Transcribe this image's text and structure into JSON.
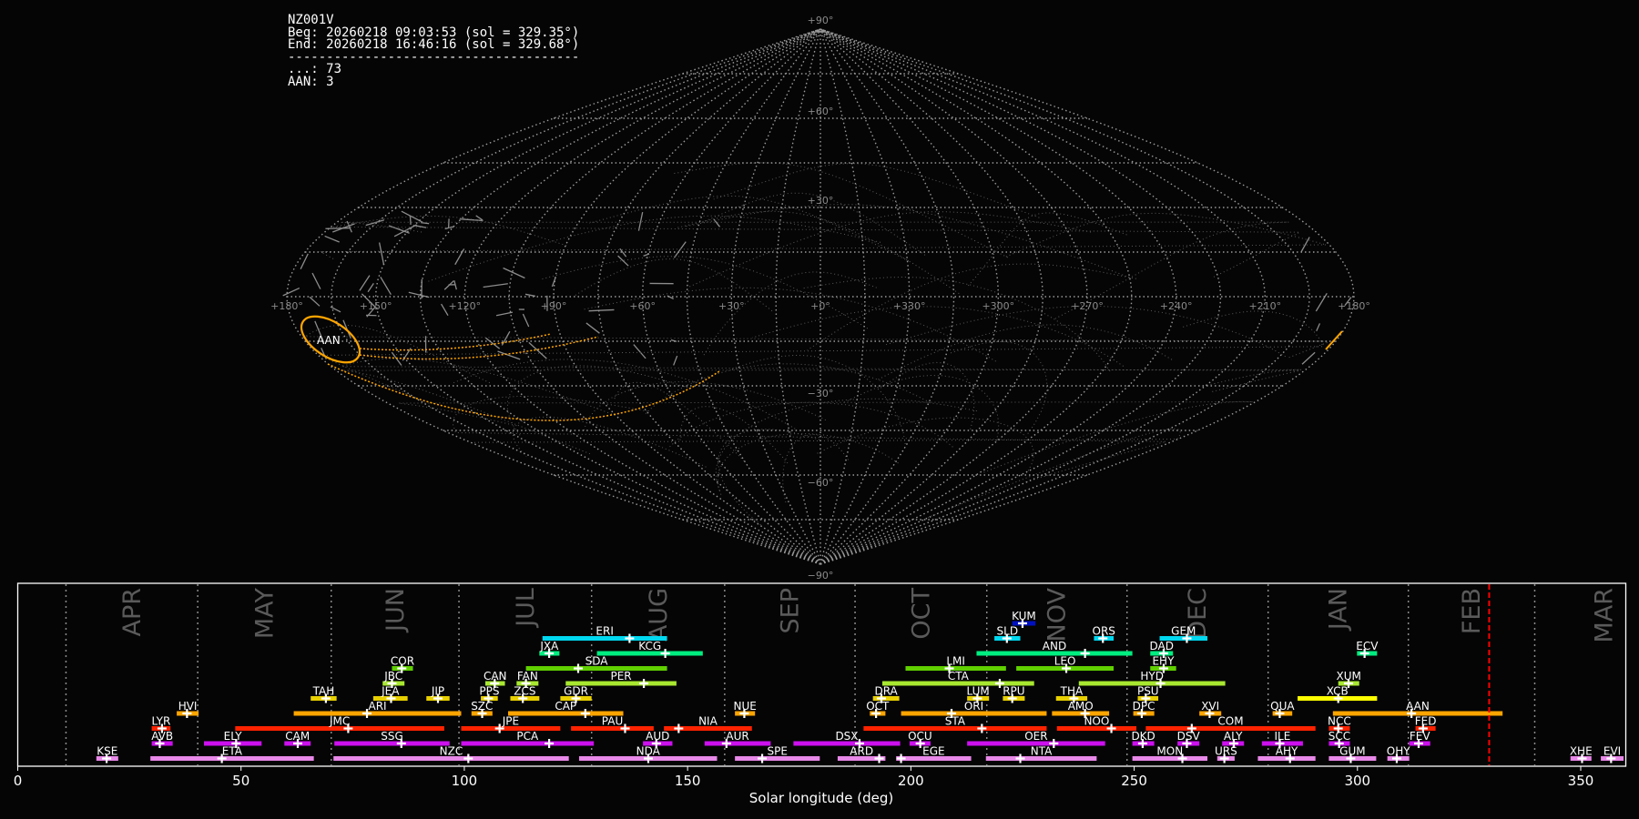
{
  "info": {
    "station": "NZ001V",
    "begin": "Beg: 20260218 09:03:53 (sol = 329.35°)",
    "end": "End: 20260218 16:46:16 (sol = 329.68°)",
    "separator": "--------------------------------------",
    "count_other": "...: 73",
    "count_aan": "AAN: 3"
  },
  "sky_map": {
    "projection": "sinusoidal",
    "lat_labels": [
      "+90°",
      "+60°",
      "+30°",
      "−30°",
      "−60°",
      "−90°"
    ],
    "lon_labels": [
      "+180°",
      "+150°",
      "+120°",
      "+90°",
      "+60°",
      "+30°",
      "+0°",
      "+330°",
      "+300°",
      "+270°",
      "+240°",
      "+210°",
      "+180°"
    ],
    "highlight_label": "AAN",
    "highlight_color": "#ffa500",
    "grid_color": "#9a9a9a"
  },
  "chart_data": {
    "type": "bar",
    "subtype": "horizontal activity-period bars with peak markers",
    "xlabel": "Solar longitude (deg)",
    "xlim": [
      0,
      360
    ],
    "xticks": [
      0,
      50,
      100,
      150,
      200,
      250,
      300,
      350
    ],
    "current_sol": 329.5,
    "current_sol_color": "#ff0000",
    "month_boundaries": [
      10.8,
      40.3,
      70.2,
      98.8,
      128.5,
      158.3,
      187.5,
      217.0,
      248.4,
      280.0,
      311.4,
      339.7
    ],
    "months": [
      "APR",
      "MAY",
      "JUN",
      "JUL",
      "AUG",
      "SEP",
      "OCT",
      "NOV",
      "DEC",
      "JAN",
      "FEB",
      "MAR"
    ],
    "showers": [
      {
        "code": "KUM",
        "beg": 222.7,
        "end": 227.9,
        "peak": 225.0,
        "row": 0,
        "color": "#0010c0"
      },
      {
        "code": "ERI",
        "beg": 117.5,
        "end": 145.4,
        "peak": 137.0,
        "row": 1,
        "color": "#00d8f0"
      },
      {
        "code": "SLD",
        "beg": 218.7,
        "end": 224.5,
        "peak": 221.5,
        "row": 1,
        "color": "#00d8f0"
      },
      {
        "code": "ORS",
        "beg": 241.0,
        "end": 245.4,
        "peak": 243.0,
        "row": 1,
        "color": "#00d8f0"
      },
      {
        "code": "GEM",
        "beg": 255.7,
        "end": 266.4,
        "peak": 261.8,
        "row": 1,
        "color": "#00d8f0"
      },
      {
        "code": "JXA",
        "beg": 116.8,
        "end": 121.3,
        "peak": 119.0,
        "row": 2,
        "color": "#00ee80"
      },
      {
        "code": "KCG",
        "beg": 129.7,
        "end": 153.4,
        "peak": 145.0,
        "row": 2,
        "color": "#00ee80"
      },
      {
        "code": "AND",
        "beg": 214.7,
        "end": 249.6,
        "peak": 239.0,
        "row": 2,
        "color": "#00ee80"
      },
      {
        "code": "DAD",
        "beg": 253.6,
        "end": 258.7,
        "peak": 256.6,
        "row": 2,
        "color": "#00ee80"
      },
      {
        "code": "ECV",
        "beg": 299.9,
        "end": 304.4,
        "peak": 301.6,
        "row": 2,
        "color": "#00ee80"
      },
      {
        "code": "COR",
        "beg": 83.8,
        "end": 88.5,
        "peak": 86.0,
        "row": 3,
        "color": "#60d000"
      },
      {
        "code": "SDA",
        "beg": 113.8,
        "end": 145.4,
        "peak": 125.5,
        "row": 3,
        "color": "#60d000"
      },
      {
        "code": "LMI",
        "beg": 198.8,
        "end": 221.3,
        "peak": 208.6,
        "row": 3,
        "color": "#60d000"
      },
      {
        "code": "LEO",
        "beg": 223.6,
        "end": 245.4,
        "peak": 234.8,
        "row": 3,
        "color": "#60d000"
      },
      {
        "code": "EHY",
        "beg": 253.6,
        "end": 259.4,
        "peak": 256.6,
        "row": 3,
        "color": "#60d000"
      },
      {
        "code": "JBC",
        "beg": 81.7,
        "end": 86.6,
        "peak": 83.8,
        "row": 4,
        "color": "#a8e830"
      },
      {
        "code": "CAN",
        "beg": 104.7,
        "end": 109.1,
        "peak": 106.8,
        "row": 4,
        "color": "#a8e830"
      },
      {
        "code": "FAN",
        "beg": 111.7,
        "end": 116.6,
        "peak": 113.8,
        "row": 4,
        "color": "#a8e830"
      },
      {
        "code": "PER",
        "beg": 122.7,
        "end": 147.5,
        "peak": 140.2,
        "row": 4,
        "color": "#a8e830"
      },
      {
        "code": "CTA",
        "beg": 193.6,
        "end": 227.6,
        "peak": 219.9,
        "row": 4,
        "color": "#a8e830"
      },
      {
        "code": "HYD",
        "beg": 237.6,
        "end": 270.4,
        "peak": 255.9,
        "row": 4,
        "color": "#a8e830"
      },
      {
        "code": "XUM",
        "beg": 295.7,
        "end": 300.4,
        "peak": 298.0,
        "row": 4,
        "color": "#a8e830"
      },
      {
        "code": "TAH",
        "beg": 65.6,
        "end": 71.4,
        "peak": 69.0,
        "row": 5,
        "color": "#e8d000"
      },
      {
        "code": "JEA",
        "beg": 79.6,
        "end": 87.3,
        "peak": 83.6,
        "row": 5,
        "color": "#e8d000"
      },
      {
        "code": "JIP",
        "beg": 91.5,
        "end": 96.7,
        "peak": 94.1,
        "row": 5,
        "color": "#e8d000"
      },
      {
        "code": "PPS",
        "beg": 103.7,
        "end": 107.5,
        "peak": 105.4,
        "row": 5,
        "color": "#e8d000"
      },
      {
        "code": "ZCS",
        "beg": 110.3,
        "end": 116.8,
        "peak": 113.1,
        "row": 5,
        "color": "#e8d000"
      },
      {
        "code": "GDR",
        "beg": 121.5,
        "end": 128.5,
        "peak": 125.0,
        "row": 5,
        "color": "#e8d000"
      },
      {
        "code": "DRA",
        "beg": 191.5,
        "end": 197.4,
        "peak": 193.4,
        "row": 5,
        "color": "#e8d000"
      },
      {
        "code": "LUM",
        "beg": 212.6,
        "end": 217.5,
        "peak": 214.9,
        "row": 5,
        "color": "#e8d000"
      },
      {
        "code": "RPU",
        "beg": 220.6,
        "end": 225.5,
        "peak": 222.7,
        "row": 5,
        "color": "#e8d000"
      },
      {
        "code": "THA",
        "beg": 232.5,
        "end": 239.5,
        "peak": 236.5,
        "row": 5,
        "color": "#e8d000"
      },
      {
        "code": "PSU",
        "beg": 250.8,
        "end": 255.4,
        "peak": 252.6,
        "row": 5,
        "color": "#e8d000"
      },
      {
        "code": "XCB",
        "beg": 286.6,
        "end": 304.4,
        "peak": 295.7,
        "row": 5,
        "color": "#ffff00"
      },
      {
        "code": "HVI",
        "beg": 35.6,
        "end": 40.5,
        "peak": 37.9,
        "row": 6,
        "color": "#ffa500"
      },
      {
        "code": "ARI",
        "beg": 61.8,
        "end": 99.3,
        "peak": 78.2,
        "row": 6,
        "color": "#ffa500"
      },
      {
        "code": "SZC",
        "beg": 101.6,
        "end": 106.3,
        "peak": 104.0,
        "row": 6,
        "color": "#ffa500"
      },
      {
        "code": "CAP",
        "beg": 109.8,
        "end": 135.6,
        "peak": 127.1,
        "row": 6,
        "color": "#ffa500"
      },
      {
        "code": "NUE",
        "beg": 160.6,
        "end": 165.1,
        "peak": 162.7,
        "row": 6,
        "color": "#ffa500"
      },
      {
        "code": "OCT",
        "beg": 190.8,
        "end": 194.3,
        "peak": 192.2,
        "row": 6,
        "color": "#ffa500"
      },
      {
        "code": "ORI",
        "beg": 197.8,
        "end": 230.4,
        "peak": 209.1,
        "row": 6,
        "color": "#ffa500"
      },
      {
        "code": "AMO",
        "beg": 231.6,
        "end": 244.4,
        "peak": 239.0,
        "row": 6,
        "color": "#ffa500"
      },
      {
        "code": "DPC",
        "beg": 249.8,
        "end": 254.5,
        "peak": 251.7,
        "row": 6,
        "color": "#ffa500"
      },
      {
        "code": "XVI",
        "beg": 264.6,
        "end": 269.5,
        "peak": 266.9,
        "row": 6,
        "color": "#ffa500"
      },
      {
        "code": "QUA",
        "beg": 281.0,
        "end": 285.4,
        "peak": 282.6,
        "row": 6,
        "color": "#ffa500"
      },
      {
        "code": "AAN",
        "beg": 294.5,
        "end": 332.5,
        "peak": 312.1,
        "row": 6,
        "color": "#ffa500"
      },
      {
        "code": "LYR",
        "beg": 30.0,
        "end": 34.2,
        "peak": 32.3,
        "row": 7,
        "color": "#ff2200"
      },
      {
        "code": "JMC",
        "beg": 48.7,
        "end": 95.5,
        "peak": 74.0,
        "row": 7,
        "color": "#ff2200"
      },
      {
        "code": "JPE",
        "beg": 99.3,
        "end": 121.5,
        "peak": 107.9,
        "row": 7,
        "color": "#ff2200"
      },
      {
        "code": "PAU",
        "beg": 123.9,
        "end": 142.4,
        "peak": 136.0,
        "row": 7,
        "color": "#ff2200"
      },
      {
        "code": "NIA",
        "beg": 144.7,
        "end": 164.4,
        "peak": 148.0,
        "row": 7,
        "color": "#ff2200"
      },
      {
        "code": "STA",
        "beg": 189.4,
        "end": 230.4,
        "peak": 215.9,
        "row": 7,
        "color": "#ff2200"
      },
      {
        "code": "NOO",
        "beg": 232.7,
        "end": 250.5,
        "peak": 244.9,
        "row": 7,
        "color": "#ff2200"
      },
      {
        "code": "COM",
        "beg": 252.6,
        "end": 290.6,
        "peak": 262.9,
        "row": 7,
        "color": "#ff2200"
      },
      {
        "code": "NCC",
        "beg": 293.6,
        "end": 298.3,
        "peak": 295.7,
        "row": 7,
        "color": "#ff2200"
      },
      {
        "code": "FED",
        "beg": 313.0,
        "end": 317.5,
        "peak": 314.7,
        "row": 7,
        "color": "#ff2200"
      },
      {
        "code": "AVB",
        "beg": 30.0,
        "end": 34.7,
        "peak": 31.8,
        "row": 8,
        "color": "#cc10ee"
      },
      {
        "code": "ELY",
        "beg": 41.7,
        "end": 54.6,
        "peak": 48.9,
        "row": 8,
        "color": "#cc10ee"
      },
      {
        "code": "CAM",
        "beg": 59.7,
        "end": 65.6,
        "peak": 62.7,
        "row": 8,
        "color": "#cc10ee"
      },
      {
        "code": "SSG",
        "beg": 70.9,
        "end": 96.7,
        "peak": 85.9,
        "row": 8,
        "color": "#cc10ee"
      },
      {
        "code": "PCA",
        "beg": 99.3,
        "end": 129.0,
        "peak": 119.0,
        "row": 8,
        "color": "#cc10ee"
      },
      {
        "code": "AUD",
        "beg": 140.0,
        "end": 146.6,
        "peak": 143.0,
        "row": 8,
        "color": "#cc10ee"
      },
      {
        "code": "AUR",
        "beg": 153.8,
        "end": 168.6,
        "peak": 158.7,
        "row": 8,
        "color": "#cc10ee"
      },
      {
        "code": "DSX",
        "beg": 173.7,
        "end": 197.6,
        "peak": 188.5,
        "row": 8,
        "color": "#cc10ee"
      },
      {
        "code": "OCU",
        "beg": 199.7,
        "end": 204.4,
        "peak": 202.1,
        "row": 8,
        "color": "#cc10ee"
      },
      {
        "code": "OER",
        "beg": 212.6,
        "end": 243.5,
        "peak": 232.0,
        "row": 8,
        "color": "#cc10ee"
      },
      {
        "code": "DKD",
        "beg": 249.6,
        "end": 254.5,
        "peak": 251.9,
        "row": 8,
        "color": "#cc10ee"
      },
      {
        "code": "DSV",
        "beg": 259.7,
        "end": 264.6,
        "peak": 261.8,
        "row": 8,
        "color": "#cc10ee"
      },
      {
        "code": "ALY",
        "beg": 269.7,
        "end": 274.6,
        "peak": 272.3,
        "row": 8,
        "color": "#cc10ee"
      },
      {
        "code": "ILE",
        "beg": 278.6,
        "end": 287.8,
        "peak": 282.6,
        "row": 8,
        "color": "#cc10ee"
      },
      {
        "code": "SCC",
        "beg": 293.6,
        "end": 298.3,
        "peak": 295.9,
        "row": 8,
        "color": "#cc10ee"
      },
      {
        "code": "FEV",
        "beg": 311.6,
        "end": 316.3,
        "peak": 313.7,
        "row": 8,
        "color": "#cc10ee"
      },
      {
        "code": "KSE",
        "beg": 17.6,
        "end": 22.5,
        "peak": 19.9,
        "row": 9,
        "color": "#e888e8"
      },
      {
        "code": "ETA",
        "beg": 29.7,
        "end": 66.3,
        "peak": 45.7,
        "row": 9,
        "color": "#e888e8"
      },
      {
        "code": "NZC",
        "beg": 70.7,
        "end": 123.4,
        "peak": 100.9,
        "row": 9,
        "color": "#e888e8"
      },
      {
        "code": "NDA",
        "beg": 125.7,
        "end": 156.6,
        "peak": 141.2,
        "row": 9,
        "color": "#e888e8"
      },
      {
        "code": "SPE",
        "beg": 160.6,
        "end": 179.6,
        "peak": 166.7,
        "row": 9,
        "color": "#e888e8"
      },
      {
        "code": "ARD",
        "beg": 183.6,
        "end": 194.3,
        "peak": 192.9,
        "row": 9,
        "color": "#e888e8"
      },
      {
        "code": "EGE",
        "beg": 196.7,
        "end": 213.5,
        "peak": 197.8,
        "row": 9,
        "color": "#e888e8"
      },
      {
        "code": "NTA",
        "beg": 216.8,
        "end": 241.6,
        "peak": 224.5,
        "row": 9,
        "color": "#e888e8"
      },
      {
        "code": "MON",
        "beg": 249.6,
        "end": 266.4,
        "peak": 260.8,
        "row": 9,
        "color": "#e888e8"
      },
      {
        "code": "URS",
        "beg": 268.6,
        "end": 272.5,
        "peak": 270.2,
        "row": 9,
        "color": "#e888e8"
      },
      {
        "code": "AHY",
        "beg": 277.7,
        "end": 290.6,
        "peak": 284.9,
        "row": 9,
        "color": "#e888e8"
      },
      {
        "code": "GUM",
        "beg": 293.6,
        "end": 304.2,
        "peak": 298.5,
        "row": 9,
        "color": "#e888e8"
      },
      {
        "code": "OHY",
        "beg": 306.7,
        "end": 311.6,
        "peak": 308.8,
        "row": 9,
        "color": "#e888e8"
      },
      {
        "code": "XHE",
        "beg": 347.7,
        "end": 352.4,
        "peak": 350.3,
        "row": 9,
        "color": "#e888e8"
      },
      {
        "code": "EVI",
        "beg": 354.5,
        "end": 359.6,
        "peak": 356.8,
        "row": 9,
        "color": "#e888e8"
      }
    ]
  }
}
